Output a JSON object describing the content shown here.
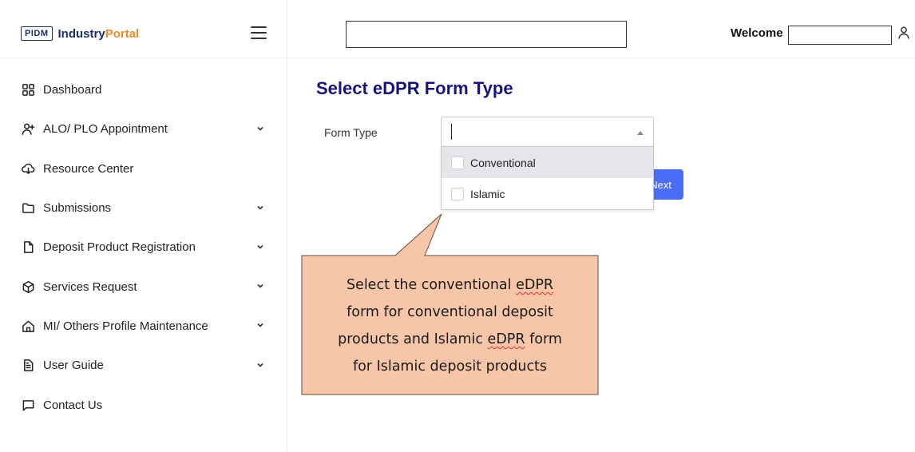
{
  "brand": {
    "logo_text": "PIDM",
    "name_part1": "Industry",
    "name_part2": "Portal"
  },
  "sidebar": {
    "items": [
      {
        "label": "Dashboard",
        "icon": "dashboard-grid-icon",
        "expandable": false
      },
      {
        "label": "ALO/ PLO Appointment",
        "icon": "user-plus-icon",
        "expandable": true
      },
      {
        "label": "Resource Center",
        "icon": "cloud-download-icon",
        "expandable": false
      },
      {
        "label": "Submissions",
        "icon": "folder-icon",
        "expandable": true
      },
      {
        "label": "Deposit Product Registration",
        "icon": "document-icon",
        "expandable": true
      },
      {
        "label": "Services Request",
        "icon": "cube-icon",
        "expandable": true
      },
      {
        "label": "MI/ Others Profile Maintenance",
        "icon": "home-icon",
        "expandable": true
      },
      {
        "label": "User Guide",
        "icon": "file-text-icon",
        "expandable": true
      },
      {
        "label": "Contact Us",
        "icon": "message-icon",
        "expandable": false
      }
    ]
  },
  "header": {
    "search_value": "",
    "welcome_label": "Welcome",
    "user_name": ""
  },
  "main": {
    "title": "Select eDPR Form Type",
    "form_type_label": "Form Type",
    "select_value": "",
    "options": [
      {
        "label": "Conventional",
        "highlighted": true
      },
      {
        "label": "Islamic",
        "highlighted": false
      }
    ],
    "next_button_label": "Next",
    "next_button_visible_text": "Next"
  },
  "callout": {
    "lines": [
      [
        "Select the conventional ",
        "eDPR",
        ""
      ],
      [
        "form for conventional deposit",
        "",
        ""
      ],
      [
        "products and Islamic ",
        "eDPR",
        " form"
      ],
      [
        "for Islamic deposit products",
        "",
        ""
      ]
    ],
    "text": "Select the conventional eDPR form for conventional deposit products and Islamic eDPR form for Islamic deposit products",
    "fill_color": "#f7c6a8",
    "border_color": "#6b4a3a"
  },
  "colors": {
    "title": "#14147a",
    "button": "#4a6cf7",
    "brand_blue": "#1a2f6b",
    "brand_orange": "#f28c28"
  }
}
